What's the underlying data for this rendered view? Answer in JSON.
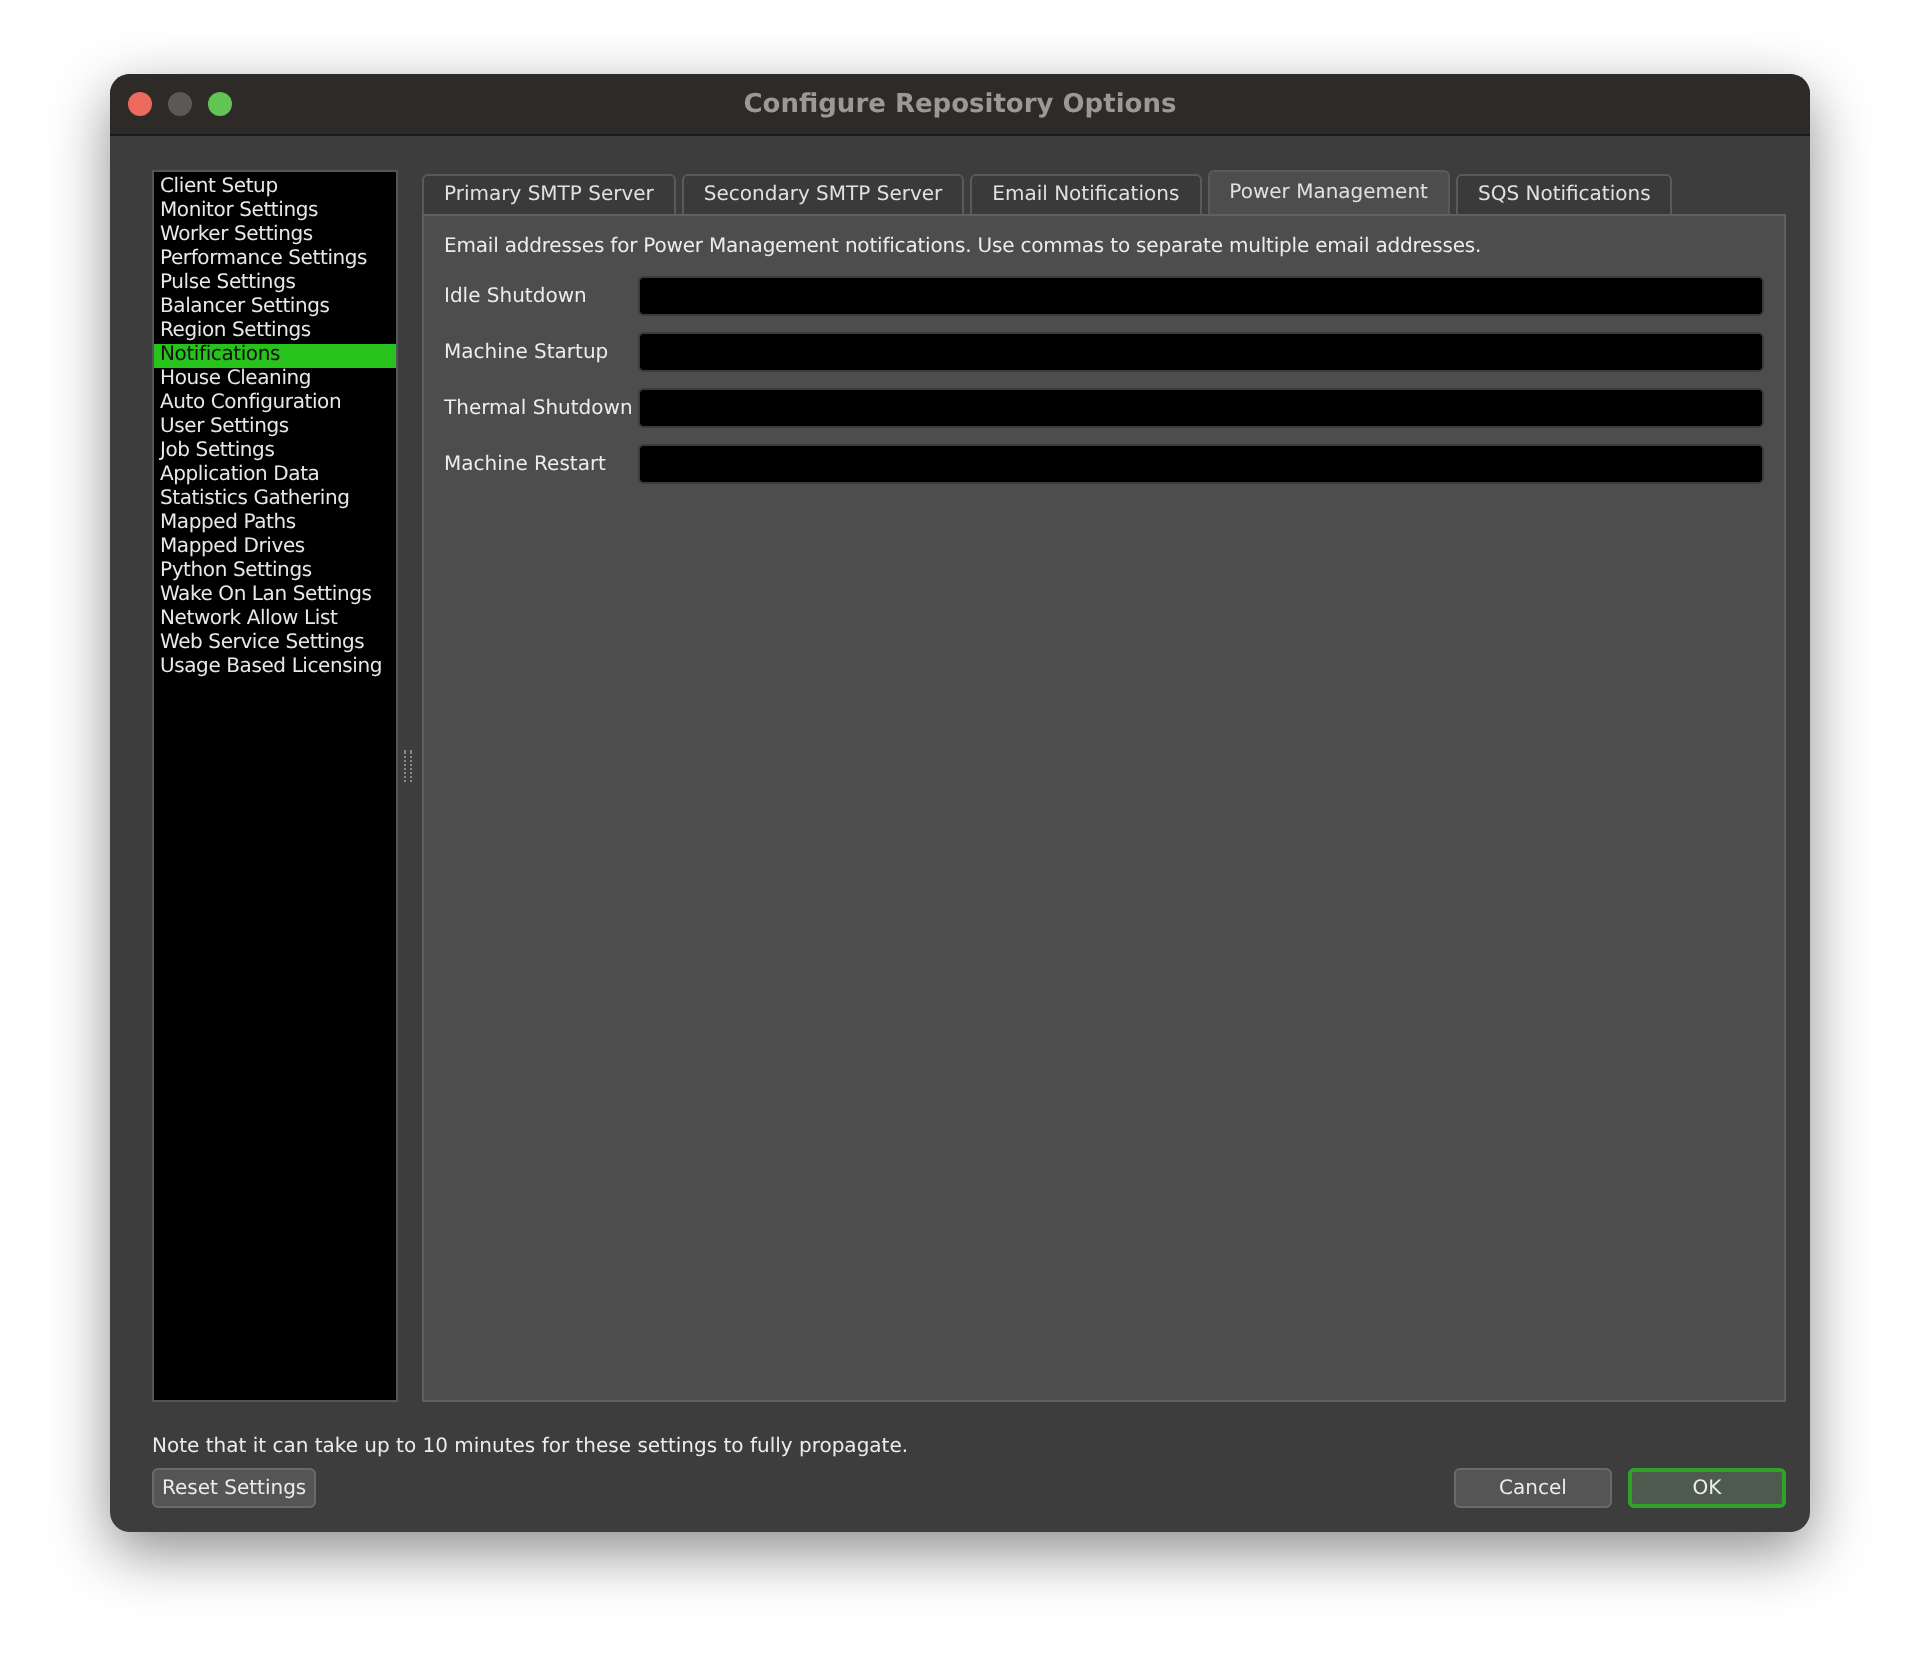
{
  "window": {
    "title": "Configure Repository Options"
  },
  "sidebar": {
    "items": [
      {
        "label": "Client Setup",
        "selected": false
      },
      {
        "label": "Monitor Settings",
        "selected": false
      },
      {
        "label": "Worker Settings",
        "selected": false
      },
      {
        "label": "Performance Settings",
        "selected": false
      },
      {
        "label": "Pulse Settings",
        "selected": false
      },
      {
        "label": "Balancer Settings",
        "selected": false
      },
      {
        "label": "Region Settings",
        "selected": false
      },
      {
        "label": "Notifications",
        "selected": true
      },
      {
        "label": "House Cleaning",
        "selected": false
      },
      {
        "label": "Auto Configuration",
        "selected": false
      },
      {
        "label": "User Settings",
        "selected": false
      },
      {
        "label": "Job Settings",
        "selected": false
      },
      {
        "label": "Application Data",
        "selected": false
      },
      {
        "label": "Statistics Gathering",
        "selected": false
      },
      {
        "label": "Mapped Paths",
        "selected": false
      },
      {
        "label": "Mapped Drives",
        "selected": false
      },
      {
        "label": "Python Settings",
        "selected": false
      },
      {
        "label": "Wake On Lan Settings",
        "selected": false
      },
      {
        "label": "Network Allow List",
        "selected": false
      },
      {
        "label": "Web Service Settings",
        "selected": false
      },
      {
        "label": "Usage Based Licensing",
        "selected": false
      }
    ]
  },
  "tabs": [
    {
      "label": "Primary SMTP Server",
      "selected": false
    },
    {
      "label": "Secondary SMTP Server",
      "selected": false
    },
    {
      "label": "Email Notifications",
      "selected": false
    },
    {
      "label": "Power Management",
      "selected": true
    },
    {
      "label": "SQS Notifications",
      "selected": false
    }
  ],
  "panel": {
    "description": "Email addresses for Power Management notifications. Use commas to separate multiple email addresses.",
    "fields": [
      {
        "label": "Idle Shutdown"
      },
      {
        "label": "Machine Startup"
      },
      {
        "label": "Thermal Shutdown"
      },
      {
        "label": "Machine Restart"
      }
    ]
  },
  "note": "Note that it can take up to 10 minutes for these settings to fully propagate.",
  "left_buttons": [
    {
      "label": "Reset Settings",
      "default": false
    }
  ],
  "right_buttons": [
    {
      "label": "Cancel",
      "default": false
    },
    {
      "label": "OK",
      "default": true
    }
  ]
}
